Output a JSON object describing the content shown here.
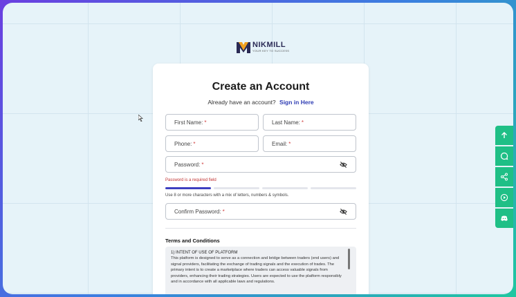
{
  "brand": {
    "name": "NIKMILL",
    "tagline": "YOUR KEY TO SUCCESS",
    "mark_color": "#f0a020",
    "mark_color2": "#2a2a55"
  },
  "form": {
    "title": "Create an Account",
    "signin_prompt": "Already have an account?",
    "signin_link": "Sign in Here",
    "first_name": "First Name:",
    "last_name": "Last Name:",
    "phone": "Phone:",
    "email": "Email:",
    "password": "Password:",
    "required_marker": "*",
    "password_error": "Password is a required field",
    "password_hint": "Use 8 or more characters with a mix of letters, numbers & symbols.",
    "strength_active_segments": 1,
    "strength_total_segments": 4,
    "confirm_password": "Confirm Password:"
  },
  "terms": {
    "title": "Terms and Conditions",
    "section_heading": "1) INTENT OF USE OF PLATFORM",
    "section_body": "This platform is designed to serve as a connection and bridge between  traders (end users) and signal providers, facilitating the exchange of  trading signals and the execution of trades. The primary intent is to  create a marketplace where traders can access valuable signals from  providers, enhancing their trading strategies. Users are expected to use the platform responsibly and in accordance with all applicable laws and regulations."
  },
  "sidebar": {
    "accent": "#1fbf86",
    "icons": [
      "arrow-up-icon",
      "chat-icon",
      "share-icon",
      "play-icon",
      "discord-icon"
    ]
  },
  "colors": {
    "link": "#2d3bb3",
    "error": "#c03030",
    "strength_active": "#3d3fc0"
  }
}
